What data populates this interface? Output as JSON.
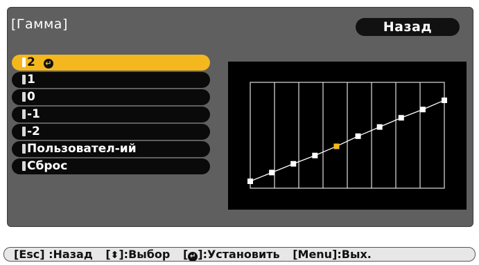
{
  "window": {
    "title": "[Гамма]",
    "back_button": "Назад"
  },
  "menu": {
    "items": [
      {
        "label": "2",
        "selected": true,
        "enter_icon": "enter-icon"
      },
      {
        "label": "1",
        "selected": false
      },
      {
        "label": "0",
        "selected": false
      },
      {
        "label": "-1",
        "selected": false
      },
      {
        "label": "-2",
        "selected": false
      },
      {
        "label": "Пользовател-ий",
        "selected": false
      },
      {
        "label": "Сброс",
        "selected": false
      }
    ]
  },
  "gamma_graph": {
    "points": [
      {
        "x": 0,
        "y": 0.0
      },
      {
        "x": 1,
        "y": 0.095
      },
      {
        "x": 2,
        "y": 0.19
      },
      {
        "x": 3,
        "y": 0.28
      },
      {
        "x": 4,
        "y": 0.38
      },
      {
        "x": 5,
        "y": 0.49
      },
      {
        "x": 6,
        "y": 0.59
      },
      {
        "x": 7,
        "y": 0.69
      },
      {
        "x": 8,
        "y": 0.78
      },
      {
        "x": 9,
        "y": 0.88
      }
    ],
    "highlight_index": 4,
    "point_color": "#ffffff",
    "highlight_color": "#f4b81e",
    "grid_color": "#e0e0e0",
    "vertical_gridlines": 8
  },
  "footer": {
    "esc": "[Esc] :Назад",
    "select_prefix": "[",
    "select_suffix": "]:Выбор",
    "enter_prefix": "[",
    "enter_suffix": "]:Установить",
    "menu": "[Menu]:Вых."
  },
  "colors": {
    "panel_bg": "#5f5f5f",
    "selected_bg": "#f4b81e",
    "item_bg": "#0a0a0a"
  }
}
